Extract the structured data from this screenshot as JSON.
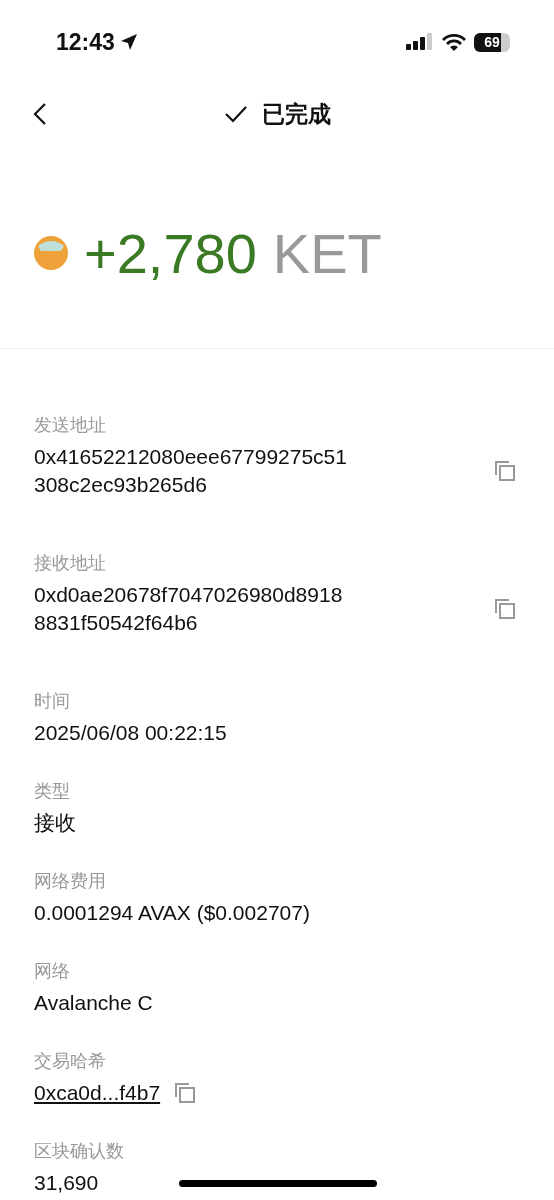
{
  "status_bar": {
    "time": "12:43",
    "battery": "69"
  },
  "header": {
    "title": "已完成"
  },
  "amount": {
    "value": "+2,780",
    "symbol": "KET"
  },
  "fields": [
    {
      "kind": "address",
      "label": "发送地址",
      "lines": [
        "0x41652212080eee67799275c51",
        "308c2ec93b265d6"
      ]
    },
    {
      "kind": "address",
      "label": "接收地址",
      "lines": [
        "0xd0ae20678f7047026980d8918",
        "8831f50542f64b6"
      ]
    },
    {
      "kind": "plain",
      "label": "时间",
      "lines": [
        "2025/06/08 00:22:15"
      ]
    },
    {
      "kind": "plain",
      "label": "类型",
      "lines": [
        "接收"
      ]
    },
    {
      "kind": "plain",
      "label": "网络费用",
      "lines": [
        "0.0001294 AVAX ($0.002707)"
      ]
    },
    {
      "kind": "plain",
      "label": "网络",
      "lines": [
        "Avalanche C"
      ]
    },
    {
      "kind": "link",
      "label": "交易哈希",
      "lines": [
        "0xca0d...f4b7"
      ]
    },
    {
      "kind": "plain",
      "label": "区块确认数",
      "lines": [
        "31,690"
      ]
    }
  ]
}
